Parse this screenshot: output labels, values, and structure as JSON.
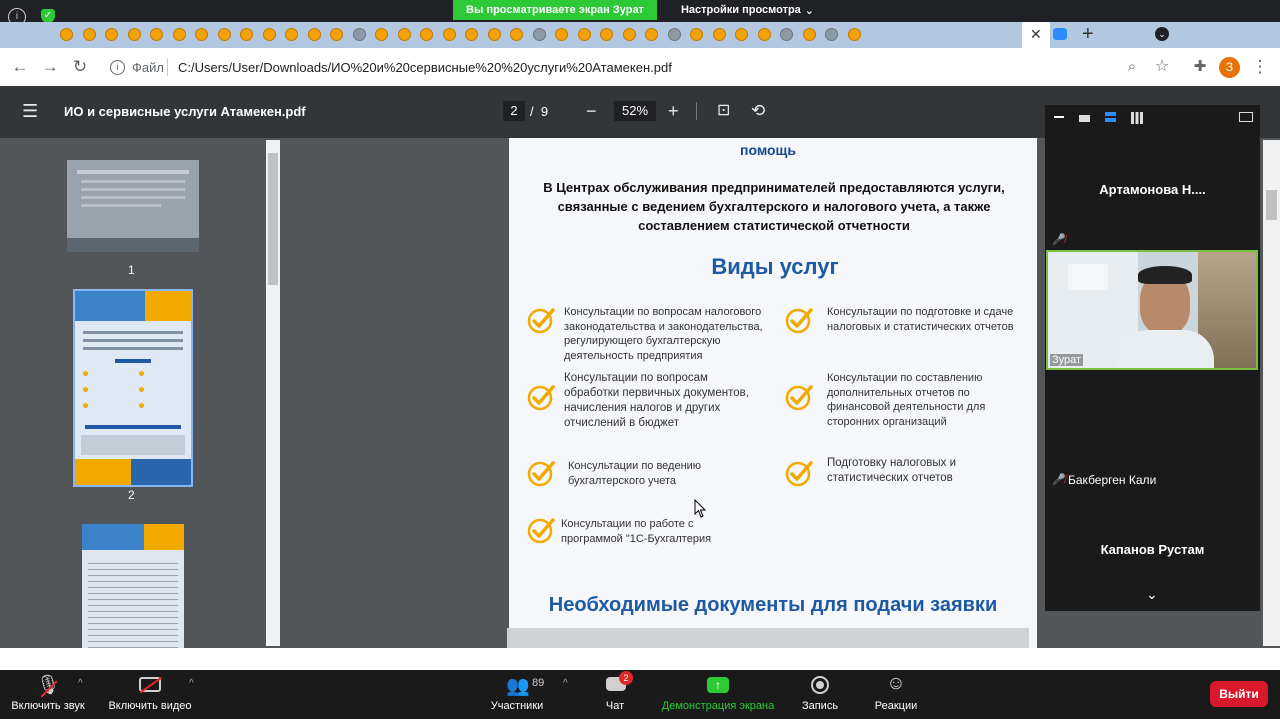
{
  "browser": {
    "share_banner": "Вы просматриваете экран Зурат",
    "view_settings": "Настройки просмотра",
    "file_label": "Файл",
    "url": "C:/Users/User/Downloads/ИО%20и%20сервисные%20%20услуги%20Атамекен.pdf",
    "profile_initial": "З"
  },
  "pdf": {
    "title": "ИО и сервисные услуги Атамекен.pdf",
    "current_page": "2",
    "page_sep": "/",
    "total_pages": "9",
    "zoom": "52%",
    "thumbnails": [
      {
        "label": "1"
      },
      {
        "label": "2"
      }
    ]
  },
  "page_content": {
    "help_word": "помощь",
    "intro": "В Центрах обслуживания предпринимателей предоставляются услуги, связанные с ведением бухгалтерского и налогового учета, а также составлением статистической отчетности",
    "services_heading": "Виды услуг",
    "services": [
      "Консультации по вопросам налогового законодательства и законодательства, регулирующего бухгалтерскую деятельность предприятия",
      "Консультации по подготовке и сдаче налоговых и статистических отчетов",
      "Консультации по вопросам обработки первичных документов, начисления налогов и других отчислений в бюджет",
      "Консультации по составлению дополнительных отчетов по финансовой деятельности для сторонних организаций",
      "Консультации по ведению бухгалтерского учета",
      "Подготовку налоговых и статистических отчетов",
      "Консультации по работе с программой \"1С-Бухгалтерия"
    ],
    "documents_heading": "Необходимые документы для подачи заявки"
  },
  "participants": {
    "p1": "Артамонова  Н....",
    "p2_cam": "Зурат",
    "p3": "Бакберген Кали",
    "p4": "Капанов Рустам"
  },
  "zoom_bar": {
    "mic": "Включить звук",
    "video": "Включить видео",
    "participants": "Участники",
    "participants_count": "89",
    "chat": "Чат",
    "chat_badge": "2",
    "share": "Демонстрация экрана",
    "record": "Запись",
    "reactions": "Реакции",
    "leave": "Выйти"
  },
  "colors": {
    "accent_green": "#2dc937",
    "heading_blue": "#1d5aa3",
    "check_orange": "#f2a900",
    "leave_red": "#d9182c"
  }
}
